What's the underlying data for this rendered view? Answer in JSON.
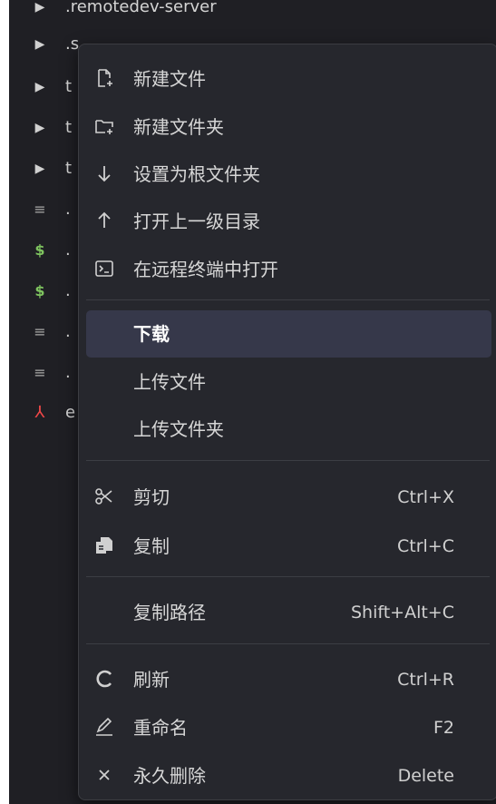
{
  "file_tree": {
    "items": [
      {
        "icon": "chevron-right-icon",
        "label": ".remotedev-server"
      },
      {
        "icon": "chevron-right-icon",
        "label": ".s"
      },
      {
        "icon": "chevron-right-icon",
        "label": "t"
      },
      {
        "icon": "chevron-right-icon",
        "label": "t"
      },
      {
        "icon": "chevron-right-icon",
        "label": "t"
      },
      {
        "icon": "text-file-icon",
        "label": "."
      },
      {
        "icon": "shell-script-icon",
        "label": "."
      },
      {
        "icon": "shell-script-icon",
        "label": "."
      },
      {
        "icon": "text-file-icon",
        "label": "."
      },
      {
        "icon": "text-file-icon",
        "label": "."
      },
      {
        "icon": "pdf-file-icon",
        "label": "e"
      }
    ]
  },
  "context_menu": {
    "new_file": {
      "label": "新建文件",
      "icon": "new-file-icon"
    },
    "new_folder": {
      "label": "新建文件夹",
      "icon": "new-folder-icon"
    },
    "set_as_root": {
      "label": "设置为根文件夹",
      "icon": "arrow-down-icon"
    },
    "open_parent": {
      "label": "打开上一级目录",
      "icon": "arrow-up-icon"
    },
    "open_in_terminal": {
      "label": "在远程终端中打开",
      "icon": "terminal-icon"
    },
    "download": {
      "label": "下载",
      "highlighted": true
    },
    "upload_file": {
      "label": "上传文件"
    },
    "upload_folder": {
      "label": "上传文件夹"
    },
    "cut": {
      "label": "剪切",
      "shortcut": "Ctrl+X",
      "icon": "scissors-icon"
    },
    "copy": {
      "label": "复制",
      "shortcut": "Ctrl+C",
      "icon": "copy-icon"
    },
    "copy_path": {
      "label": "复制路径",
      "shortcut": "Shift+Alt+C"
    },
    "refresh": {
      "label": "刷新",
      "shortcut": "Ctrl+R",
      "icon": "refresh-icon"
    },
    "rename": {
      "label": "重命名",
      "shortcut": "F2",
      "icon": "pencil-icon"
    },
    "delete": {
      "label": "永久删除",
      "shortcut": "Delete",
      "icon": "close-icon"
    }
  },
  "colors": {
    "explorer_background": "#1f1f24",
    "menu_background": "#26272d",
    "highlight_background": "#36384a",
    "text": "#d7d7d7",
    "shell_icon": "#7ec35f",
    "pdf_icon": "#f04747"
  }
}
